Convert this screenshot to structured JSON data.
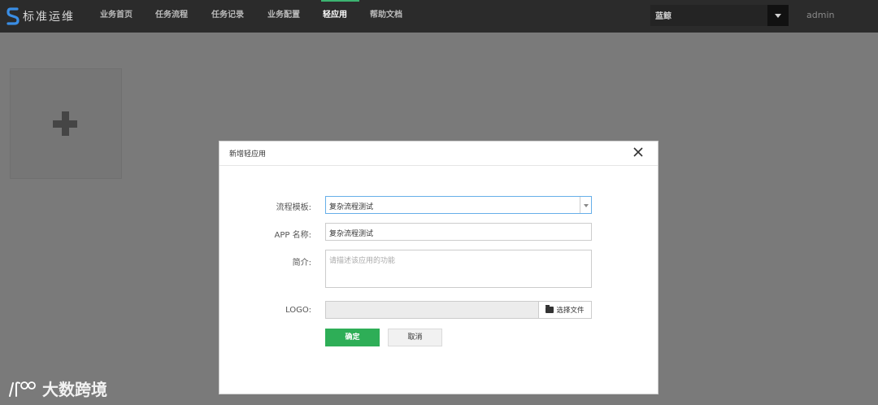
{
  "brand": {
    "name": "标准运维"
  },
  "nav": {
    "items": [
      {
        "label": "业务首页"
      },
      {
        "label": "任务流程"
      },
      {
        "label": "任务记录"
      },
      {
        "label": "业务配置"
      },
      {
        "label": "轻应用"
      },
      {
        "label": "帮助文档"
      }
    ],
    "active_index": 4
  },
  "biz_selector": {
    "value": "蓝鲸"
  },
  "user": {
    "name": "admin"
  },
  "modal": {
    "title": "新增轻应用",
    "template_label": "流程模板:",
    "template_value": "复杂流程测试",
    "app_name_label": "APP 名称:",
    "app_name_value": "复杂流程测试",
    "desc_label": "简介:",
    "desc_placeholder": "请描述该应用的功能",
    "logo_label": "LOGO:",
    "file_button_label": "选择文件",
    "ok_label": "确定",
    "cancel_label": "取消"
  },
  "watermark": {
    "text": "大数跨境"
  },
  "colors": {
    "navbar": "#2b2b2b",
    "accent": "#2eae57",
    "focus_border": "#66afe9"
  }
}
